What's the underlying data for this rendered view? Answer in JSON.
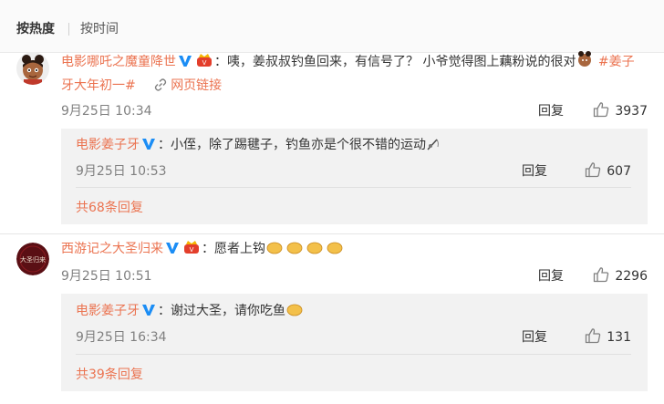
{
  "sort": {
    "hot": "按热度",
    "time": "按时间"
  },
  "comments": [
    {
      "user": "电影哪吒之魔童降世",
      "text_prefix": "：咦，姜叔叔钓鱼回来，有信号了？ 小爷觉得图上藕粉说的很对",
      "topic": "#姜子牙大年初一#",
      "link_label": "网页链接",
      "time": "9月25日 10:34",
      "reply_label": "回复",
      "likes": "3937",
      "sub": {
        "user": "电影姜子牙",
        "text": "：小侄，除了踢毽子，钓鱼亦是个很不错的运动",
        "time": "9月25日 10:53",
        "reply_label": "回复",
        "likes": "607",
        "more": "共68条回复"
      }
    },
    {
      "user": "西游记之大圣归来",
      "text": "：愿者上钩",
      "time": "9月25日 10:51",
      "reply_label": "回复",
      "likes": "2296",
      "avatar_text": "大圣归来",
      "sub": {
        "user": "电影姜子牙",
        "text": "：谢过大圣，请你吃鱼",
        "time": "9月25日 16:34",
        "reply_label": "回复",
        "likes": "131",
        "more": "共39条回复"
      }
    }
  ],
  "colors": {
    "accent": "#eb7350",
    "verified": "#1b8df5",
    "subbox": "#f2f2f2"
  }
}
